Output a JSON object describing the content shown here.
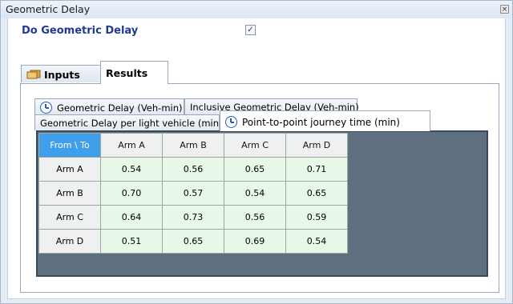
{
  "window": {
    "title": "Geometric Delay",
    "close_icon": "×"
  },
  "toggle": {
    "label": "Do Geometric Delay",
    "checked": true,
    "check_mark": "✓"
  },
  "main_tabs": {
    "inputs": "Inputs",
    "results": "Results"
  },
  "sub_tabs": [
    "Geometric Delay (Veh-min)",
    "Inclusive Geometric Delay (Veh-min)",
    "Geometric Delay per light vehicle (min)",
    "Point-to-point journey time (min)"
  ],
  "grid": {
    "corner": "From \\ To",
    "columns": [
      "Arm A",
      "Arm B",
      "Arm C",
      "Arm D"
    ],
    "rows": [
      {
        "label": "Arm A",
        "values": [
          "0.54",
          "0.56",
          "0.65",
          "0.71"
        ]
      },
      {
        "label": "Arm B",
        "values": [
          "0.70",
          "0.57",
          "0.54",
          "0.65"
        ]
      },
      {
        "label": "Arm C",
        "values": [
          "0.64",
          "0.73",
          "0.56",
          "0.59"
        ]
      },
      {
        "label": "Arm D",
        "values": [
          "0.51",
          "0.65",
          "0.69",
          "0.54"
        ]
      }
    ]
  }
}
